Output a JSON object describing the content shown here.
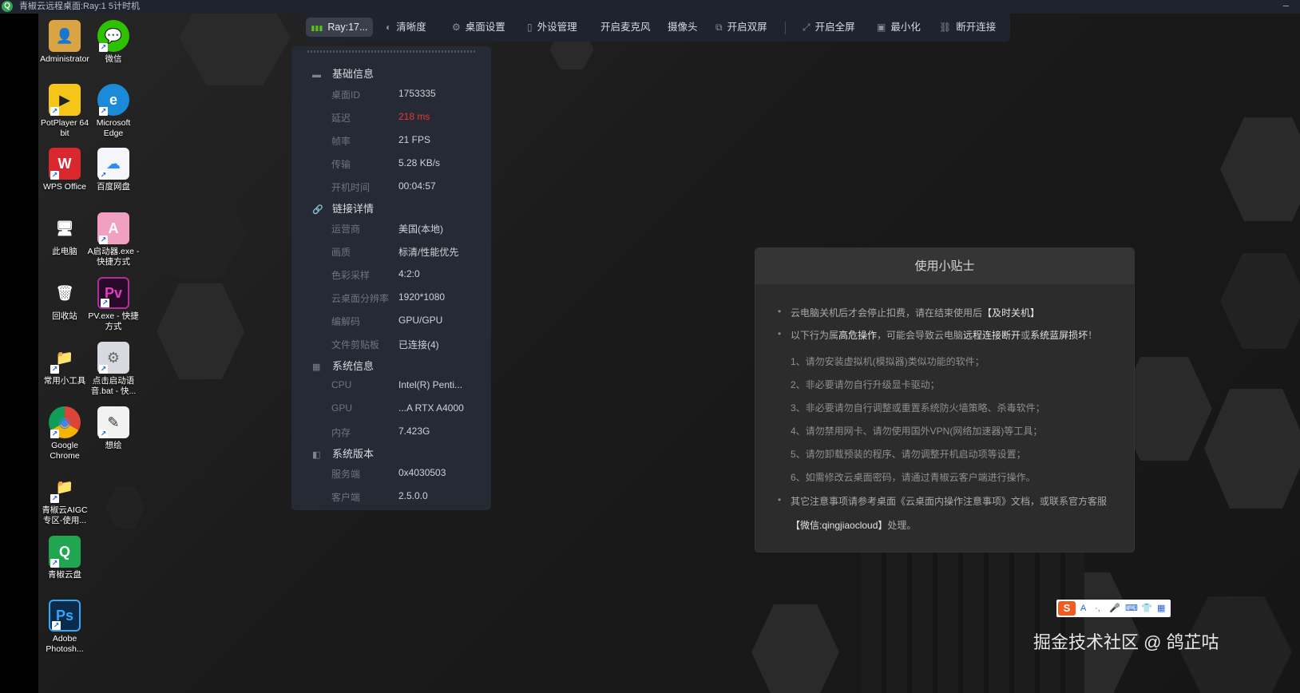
{
  "window": {
    "title": "青椒云远程桌面:Ray:1        5计时机",
    "minimize_glyph": "–"
  },
  "toolbar": {
    "user": "Ray:17...",
    "items": [
      {
        "label": "清晰度",
        "icon": "clarity-icon"
      },
      {
        "label": "桌面设置",
        "icon": "gear-icon"
      },
      {
        "label": "外设管理",
        "icon": "mouse-icon"
      },
      {
        "label": "开启麦克风",
        "icon": ""
      },
      {
        "label": "摄像头",
        "icon": ""
      },
      {
        "label": "开启双屏",
        "icon": "dual-screen-icon"
      },
      {
        "label": "开启全屏",
        "icon": "fullscreen-icon"
      },
      {
        "label": "最小化",
        "icon": "minimize-icon"
      },
      {
        "label": "断开连接",
        "icon": "disconnect-icon"
      }
    ]
  },
  "panel": {
    "sections": [
      {
        "title": "基础信息",
        "rows": [
          {
            "k": "桌面ID",
            "v": "1753335"
          },
          {
            "k": "延迟",
            "v": "218 ms"
          },
          {
            "k": "帧率",
            "v": "21 FPS"
          },
          {
            "k": "传输",
            "v": "5.28 KB/s"
          },
          {
            "k": "开机时间",
            "v": "00:04:57"
          }
        ]
      },
      {
        "title": "链接详情",
        "rows": [
          {
            "k": "运营商",
            "v": "美国(本地)"
          },
          {
            "k": "画质",
            "v": "标清/性能优先"
          },
          {
            "k": "色彩采样",
            "v": "4:2:0"
          },
          {
            "k": "云桌面分辨率",
            "v": "1920*1080"
          },
          {
            "k": "编解码",
            "v": "GPU/GPU"
          },
          {
            "k": "文件剪贴板",
            "v": "已连接(4)"
          }
        ]
      },
      {
        "title": "系统信息",
        "rows": [
          {
            "k": "CPU",
            "v": "Intel(R) Penti..."
          },
          {
            "k": "GPU",
            "v": "...A RTX A4000"
          },
          {
            "k": "内存",
            "v": "7.423G"
          }
        ]
      },
      {
        "title": "系统版本",
        "rows": [
          {
            "k": "服务端",
            "v": "0x4030503"
          },
          {
            "k": "客户端",
            "v": "2.5.0.0"
          }
        ]
      }
    ]
  },
  "tips": {
    "title": "使用小贴士",
    "l1_a": "云电脑关机后才会停止扣费，请在结束使用后",
    "l1_b": "【及时关机】",
    "l2_a": "以下行为属",
    "l2_b": "高危操作",
    "l2_c": "，可能会导致云电脑",
    "l2_d": "远程连接断开",
    "l2_e": "或",
    "l2_f": "系统蓝屏损坏",
    "l2_g": "！",
    "sub": [
      "1、请勿安装虚拟机(模拟器)类似功能的软件；",
      "2、非必要请勿自行升级显卡驱动；",
      "3、非必要请勿自行调整或重置系统防火墙策略、杀毒软件；",
      "4、请勿禁用网卡、请勿使用国外VPN(网络加速器)等工具；",
      "5、请勿卸载预装的程序、请勿调整开机启动项等设置；",
      "6、如需修改云桌面密码，请通过青椒云客户端进行操作。"
    ],
    "l3": "其它注意事项请参考桌面《云桌面内操作注意事项》文档，或联系官方客服",
    "l4_a": "【微信:qingjiaocloud】",
    "l4_b": "处理。"
  },
  "desktop_icons": [
    {
      "label": "Administrator",
      "glyph": "👤",
      "color": "#d9a441"
    },
    {
      "label": "微信",
      "glyph": "💬",
      "color": "#2dc100"
    },
    {
      "label": "PotPlayer 64 bit",
      "glyph": "▶",
      "color": "#f5c518"
    },
    {
      "label": "Microsoft Edge",
      "glyph": "e",
      "color": "#1b8ad8"
    },
    {
      "label": "WPS Office",
      "glyph": "W",
      "color": "#d9272e"
    },
    {
      "label": "百度网盘",
      "glyph": "☁",
      "color": "#2b8cf7"
    },
    {
      "label": "此电脑",
      "glyph": "🖥",
      "color": "#3a7bd5"
    },
    {
      "label": "A启动器.exe - 快捷方式",
      "glyph": "A",
      "color": "#f0a0c0"
    },
    {
      "label": "回收站",
      "glyph": "🗑",
      "color": "#8fa8c0"
    },
    {
      "label": "PV.exe - 快捷方式",
      "glyph": "Pv",
      "color": "#b0309a"
    },
    {
      "label": "常用小工具",
      "glyph": "📁",
      "color": "#e2b43c"
    },
    {
      "label": "点击启动语音.bat - 快...",
      "glyph": "⚙",
      "color": "#aab0b8"
    },
    {
      "label": "Google Chrome",
      "glyph": "◉",
      "color": "#db4437"
    },
    {
      "label": "想绘",
      "glyph": "✎",
      "color": "#eeeeee"
    },
    {
      "label": "青椒云AIGC专区-使用...",
      "glyph": "📁",
      "color": "#e2b43c"
    },
    {
      "label": "青椒云盘",
      "glyph": "Q",
      "color": "#20a650"
    },
    {
      "label": "Adobe Photosh...",
      "glyph": "Ps",
      "color": "#0c2a4a"
    }
  ],
  "ime": {
    "brand": "S",
    "items": [
      "A",
      "·,",
      "🎤",
      "⌨",
      "👕",
      "▦"
    ]
  },
  "watermark": "掘金技术社区 @ 鸽芷咕",
  "colors": {
    "latency_red": "#e53935",
    "panel_bg": "#262a35",
    "toolbar_bg": "#1f232e"
  }
}
